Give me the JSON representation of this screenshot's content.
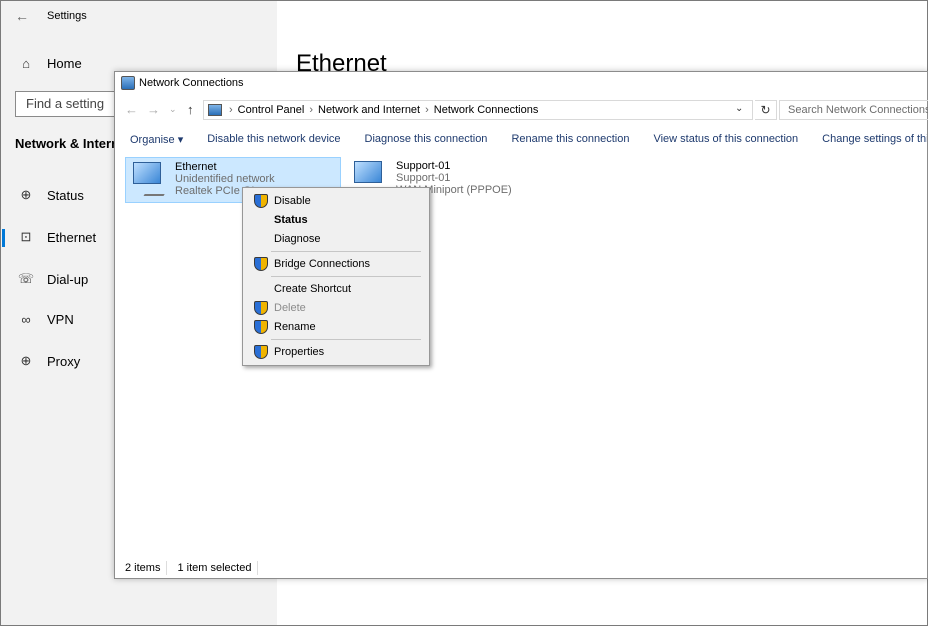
{
  "settings": {
    "title": "Settings",
    "home_label": "Home",
    "search_placeholder": "Find a setting",
    "section_title": "Network & Internet",
    "nav": [
      {
        "label": "Status",
        "icon": "globe-status-icon"
      },
      {
        "label": "Ethernet",
        "icon": "ethernet-icon"
      },
      {
        "label": "Dial-up",
        "icon": "dialup-icon"
      },
      {
        "label": "VPN",
        "icon": "vpn-icon"
      },
      {
        "label": "Proxy",
        "icon": "proxy-globe-icon"
      }
    ],
    "selected_nav": "Ethernet",
    "page_heading": "Ethernet",
    "accent_color": "#0078d7"
  },
  "network_connections": {
    "window_title": "Network Connections",
    "breadcrumb": [
      "Control Panel",
      "Network and Internet",
      "Network Connections"
    ],
    "search_placeholder": "Search Network Connections",
    "commands": [
      "Organise ▾",
      "Disable this network device",
      "Diagnose this connection",
      "Rename this connection",
      "View status of this connection",
      "Change settings of this connection"
    ],
    "items": [
      {
        "name": "Ethernet",
        "status": "Unidentified network",
        "device": "Realtek PCIe GI",
        "selected": true
      },
      {
        "name": "Support-01",
        "status": "Support-01",
        "device": "WAN Miniport (PPPOE)",
        "selected": false
      }
    ],
    "status_bar": {
      "count": "2 items",
      "selection": "1 item selected"
    }
  },
  "context_menu": {
    "items": [
      {
        "label": "Disable",
        "shield": true,
        "bold": false,
        "disabled": false
      },
      {
        "label": "Status",
        "shield": false,
        "bold": true,
        "disabled": false
      },
      {
        "label": "Diagnose",
        "shield": false,
        "bold": false,
        "disabled": false
      },
      {
        "label": "Bridge Connections",
        "shield": true,
        "bold": false,
        "disabled": false
      },
      {
        "label": "Create Shortcut",
        "shield": false,
        "bold": false,
        "disabled": false
      },
      {
        "label": "Delete",
        "shield": true,
        "bold": false,
        "disabled": true
      },
      {
        "label": "Rename",
        "shield": true,
        "bold": false,
        "disabled": false
      },
      {
        "label": "Properties",
        "shield": true,
        "bold": false,
        "disabled": false
      }
    ]
  }
}
